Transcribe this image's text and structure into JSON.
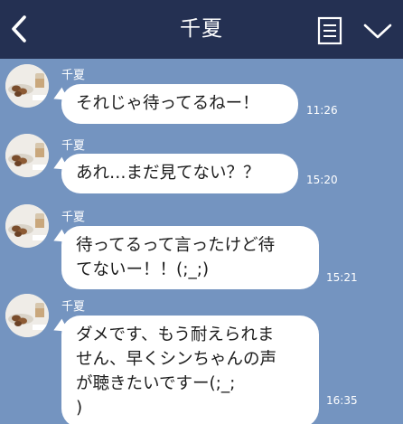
{
  "header": {
    "title": "千夏",
    "back_icon": "chevron-left-icon",
    "note_icon": "note-icon",
    "menu_icon": "chevron-down-icon"
  },
  "messages": [
    {
      "sender": "千夏",
      "text": "それじゃ待ってるねー！",
      "time": "11:26"
    },
    {
      "sender": "千夏",
      "text": "あれ…まだ見てない？？",
      "time": "15:20"
    },
    {
      "sender": "千夏",
      "text": "待ってるって言ったけど待\nてないー！！(;_;)",
      "time": "15:21"
    },
    {
      "sender": "千夏",
      "text": "ダメです、もう耐えられま\nせん、早くシンちゃんの声\nが聴きたいですー(;_;\n)",
      "time": "16:35"
    }
  ],
  "colors": {
    "header_bg": "#243052",
    "chat_bg": "#7494c0",
    "bubble_bg": "#ffffff"
  }
}
